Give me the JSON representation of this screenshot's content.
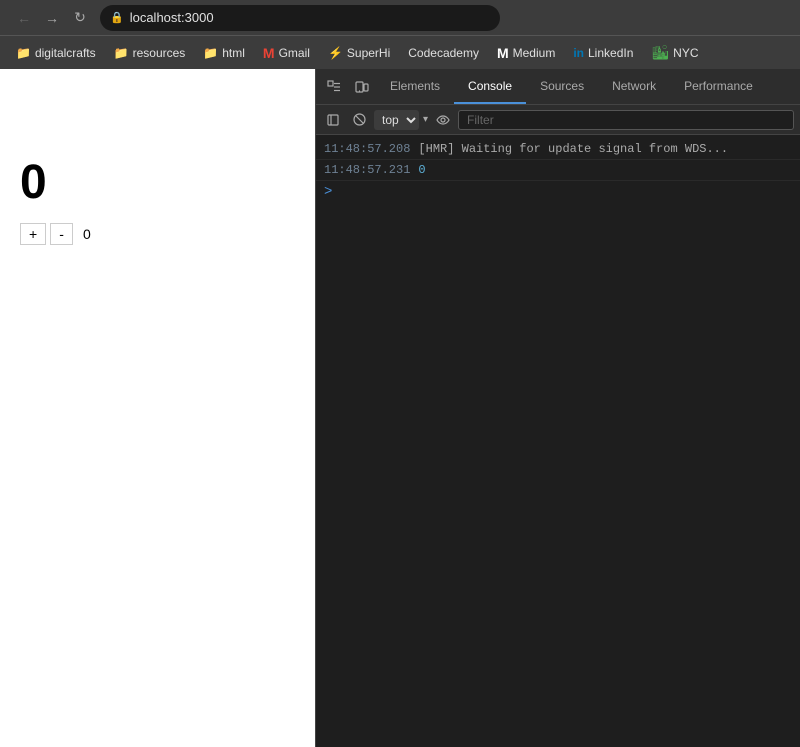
{
  "browser": {
    "address": "localhost:3000",
    "nav": {
      "back_label": "←",
      "forward_label": "→",
      "reload_label": "↻"
    },
    "bookmarks": [
      {
        "id": "digitalcrafts",
        "label": "digitalcrafts",
        "icon": "📁",
        "type": "folder"
      },
      {
        "id": "resources",
        "label": "resources",
        "icon": "📁",
        "type": "folder"
      },
      {
        "id": "html",
        "label": "html",
        "icon": "📁",
        "type": "folder"
      },
      {
        "id": "gmail",
        "label": "Gmail",
        "icon": "M",
        "type": "gmail"
      },
      {
        "id": "superhi",
        "label": "SuperHi",
        "icon": "S",
        "type": "superhi"
      },
      {
        "id": "codecademy",
        "label": "Codecademy",
        "icon": "C",
        "type": "text"
      },
      {
        "id": "medium",
        "label": "Medium",
        "icon": "M",
        "type": "medium"
      },
      {
        "id": "linkedin",
        "label": "LinkedIn",
        "icon": "in",
        "type": "linkedin"
      },
      {
        "id": "nyc",
        "label": "NYC",
        "icon": "🏙",
        "type": "nyc"
      }
    ]
  },
  "page": {
    "counter_value": "0",
    "plus_label": "+",
    "minus_label": "-",
    "counter_display": "0"
  },
  "devtools": {
    "tabs": [
      {
        "id": "elements",
        "label": "Elements",
        "active": false
      },
      {
        "id": "console",
        "label": "Console",
        "active": true
      },
      {
        "id": "sources",
        "label": "Sources",
        "active": false
      },
      {
        "id": "network",
        "label": "Network",
        "active": false
      },
      {
        "id": "performance",
        "label": "Performance",
        "active": false
      }
    ],
    "console": {
      "context": "top",
      "filter_placeholder": "Filter",
      "messages": [
        {
          "timestamp": "11:48:57.208",
          "text": "[HMR] Waiting for update signal from WDS...",
          "type": "hmr"
        },
        {
          "timestamp": "11:48:57.231",
          "text": "0",
          "type": "number"
        }
      ],
      "prompt_symbol": ">"
    }
  }
}
